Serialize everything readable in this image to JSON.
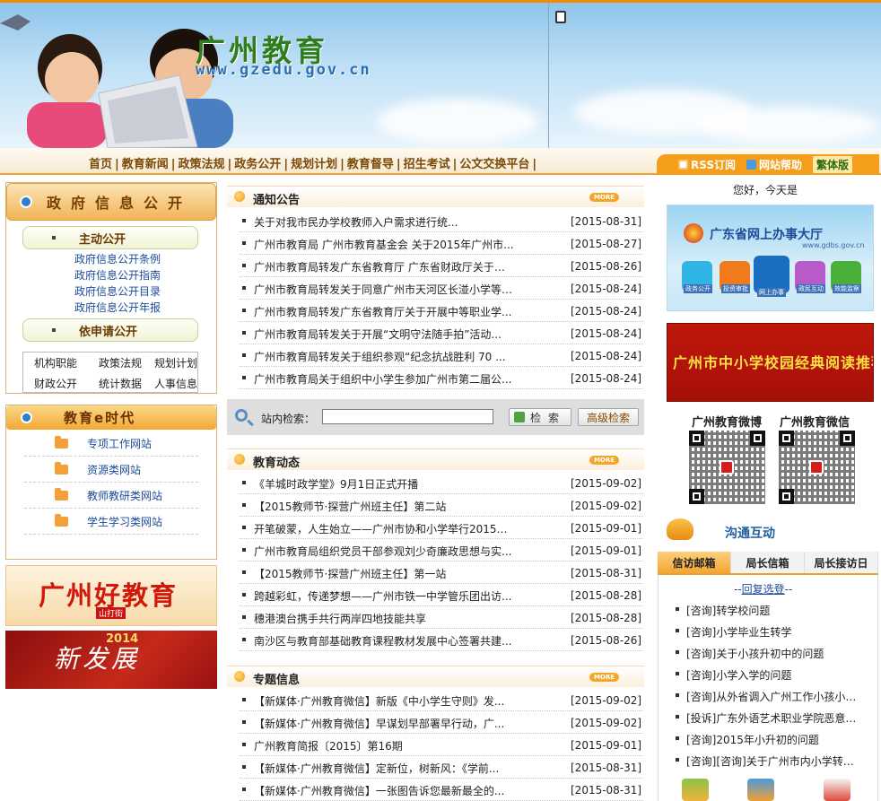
{
  "header": {
    "logo_text": "广州教育",
    "logo_url": "www.gzedu.gov.cn"
  },
  "nav": {
    "links": [
      "首页",
      "教育新闻",
      "政策法规",
      "政务公开",
      "规划计划",
      "教育督导",
      "招生考试",
      "公文交换平台"
    ],
    "separator": "|",
    "rss": "RSS订阅",
    "help": "网站帮助",
    "traditional": "繁体版"
  },
  "gov_info": {
    "title": "政府信息公开",
    "active_head": "主动公开",
    "active_links": [
      "政府信息公开条例",
      "政府信息公开指南",
      "政府信息公开目录",
      "政府信息公开年报"
    ],
    "request_head": "依申请公开",
    "categories": [
      "机构职能",
      "政策法规",
      "规划计划",
      "财政公开",
      "统计数据",
      "人事信息"
    ]
  },
  "edu_era": {
    "title": "教育e时代",
    "items": [
      "专项工作网站",
      "资源类网站",
      "教师教研类网站",
      "学生学习类网站"
    ]
  },
  "promos": {
    "good_edu": "广州好教育",
    "good_edu_sub": "山打街",
    "new_dev": "新发展",
    "new_dev_year": "2014"
  },
  "notices": {
    "title": "通知公告",
    "more": "MORE",
    "items": [
      {
        "text": "关于对我市民办学校教师入户需求进行统...",
        "date": "[2015-08-31]"
      },
      {
        "text": "广州市教育局 广州市教育基金会 关于2015年广州市...",
        "date": "[2015-08-27]"
      },
      {
        "text": "广州市教育局转发广东省教育厅 广东省财政厅关于申...",
        "date": "[2015-08-26]"
      },
      {
        "text": "广州市教育局转发关于同意广州市天河区长湴小学等4...",
        "date": "[2015-08-24]"
      },
      {
        "text": "广州市教育局转发广东省教育厅关于开展中等职业学...",
        "date": "[2015-08-24]"
      },
      {
        "text": "广州市教育局转发关于开展“文明守法随手拍”活动...",
        "date": "[2015-08-24]"
      },
      {
        "text": "广州市教育局转发关于组织参观“纪念抗战胜利 70 ...",
        "date": "[2015-08-24]"
      },
      {
        "text": "广州市教育局关于组织中小学生参加广州市第二届公...",
        "date": "[2015-08-24]"
      }
    ]
  },
  "search": {
    "label": "站内检索：",
    "value": "",
    "button": "检索",
    "advanced": "高级检索"
  },
  "dynamics": {
    "title": "教育动态",
    "more": "MORE",
    "items": [
      {
        "text": "《羊城时政学堂》9月1日正式开播",
        "date": "[2015-09-02]"
      },
      {
        "text": "【2015教师节·探营广州班主任】第二站",
        "date": "[2015-09-02]"
      },
      {
        "text": "开笔破蒙，人生始立——广州市协和小学举行2015级...",
        "date": "[2015-09-01]"
      },
      {
        "text": "广州市教育局组织党员干部参观刘少奇廉政思想与实...",
        "date": "[2015-09-01]"
      },
      {
        "text": "【2015教师节·探营广州班主任】第一站",
        "date": "[2015-08-31]"
      },
      {
        "text": "跨越彩虹，传递梦想——广州市铁一中学管乐团出访...",
        "date": "[2015-08-28]"
      },
      {
        "text": "穗港澳台携手共行两岸四地技能共享",
        "date": "[2015-08-28]"
      },
      {
        "text": "南沙区与教育部基础教育课程教材发展中心签署共建...",
        "date": "[2015-08-26]"
      }
    ]
  },
  "topics": {
    "title": "专题信息",
    "more": "MORE",
    "items": [
      {
        "text": "【新媒体·广州教育微信】新版《中小学生守则》发...",
        "date": "[2015-09-02]"
      },
      {
        "text": "【新媒体·广州教育微信】早谋划早部署早行动，广...",
        "date": "[2015-09-02]"
      },
      {
        "text": "广州教育简报〔2015〕第16期",
        "date": "[2015-09-01]"
      },
      {
        "text": "【新媒体·广州教育微信】定新位，树新风：《学前...",
        "date": "[2015-08-31]"
      },
      {
        "text": "【新媒体·广州教育微信】一张图告诉您最新最全的...",
        "date": "[2015-08-31]"
      }
    ]
  },
  "right": {
    "greeting": "您好，今天是",
    "gd_hall": "广东省网上办事大厅",
    "gd_url": "www.gdbs.gov.cn",
    "gd_icons": [
      "政务公开",
      "投资审批",
      "网上办事",
      "政民互动",
      "效能监察"
    ],
    "reading": "广州市中小学校园经典阅读推荐书目提要",
    "weibo_label": "广州教育微博",
    "wechat_label": "广州教育微信",
    "comm_title": "沟通互动",
    "tabs": [
      "信访邮箱",
      "局长信箱",
      "局长接访日"
    ],
    "active_tab": "信访邮箱",
    "reply_prefix": "--",
    "reply_link": "回复选登",
    "reply_suffix": "--",
    "mail_items": [
      "[咨询]转学校问题",
      "[咨询]小学毕业生转学",
      "[咨询]关于小孩升初中的问题",
      "[咨询]小学入学的问题",
      "[咨询]从外省调入广州工作小孩小学...",
      "[投诉]广东外语艺术职业学院恶意扣...",
      "[咨询]2015年小升初的问题",
      "[咨询][咨询]关于广州市内小学转学..."
    ]
  },
  "colors": {
    "accent_orange": "#f0a030",
    "link_blue": "#1b4b9a",
    "nav_brown": "#7a4a08"
  }
}
